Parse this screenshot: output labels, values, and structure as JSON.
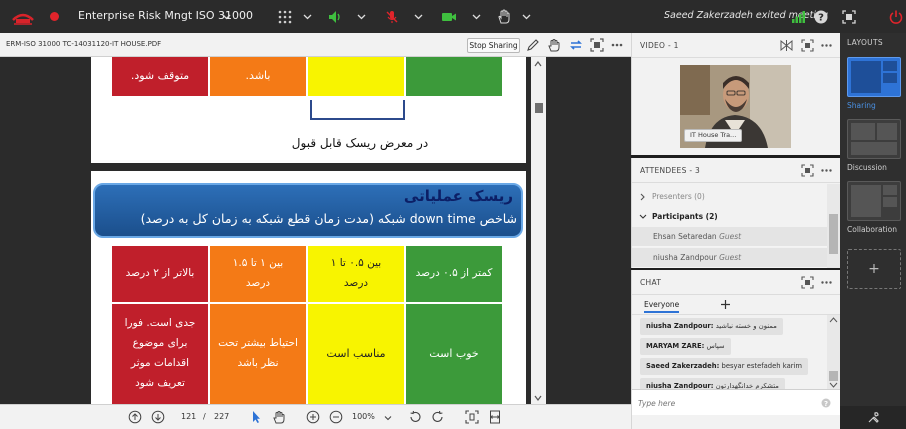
{
  "topbar": {
    "meeting_title": "Enterprise Risk Mngt ISO 31000",
    "status_message": "Saeed Zakerzadeh exited meeting"
  },
  "document": {
    "file_name": "ERM-ISO 31000 TC-14031120-IT HOUSE.PDF",
    "stop_sharing": "Stop Sharing",
    "current_page": "121",
    "page_separator": "/",
    "total_pages": "227",
    "zoom": "100%"
  },
  "slide_top": {
    "cells": [
      "متوقف شود.",
      "باشد."
    ],
    "acceptable_label": "در معرض ریسک قابل قبول"
  },
  "slide_bottom": {
    "title": "ریسک عملیاتی",
    "subtitle": "شاخص down time شبکه (مدت زمان قطع شبکه به زمان کل به درصد)",
    "header_cells": [
      "بالاتر از ۲ درصد",
      "بین ۱ تا ۱.۵ درصد",
      "بین ۰.۵ تا ۱ درصد",
      "کمتر از ۰.۵ درصد"
    ],
    "body_cells": [
      "جدی است. فورا برای موضوع اقدامات موثر تعریف شود",
      "احتیاط بیشتر تحت نظر باشد",
      "مناسب است",
      "خوب است"
    ]
  },
  "video_panel": {
    "title": "VIDEO",
    "count": "- 1",
    "video_label": "IT House Tra..."
  },
  "attendees_panel": {
    "title": "ATTENDEES",
    "count": "- 3",
    "presenters": "Presenters (0)",
    "participants": "Participants (2)",
    "people": [
      {
        "name": "Ehsan Setaredan",
        "role": "Guest"
      },
      {
        "name": "niusha Zandpour",
        "role": "Guest"
      }
    ]
  },
  "chat_panel": {
    "title": "CHAT",
    "tab": "Everyone",
    "messages": [
      {
        "sender": "niusha Zandpour:",
        "text": "ممنون و خسته نباشید"
      },
      {
        "sender": "MARYAM ZARE:",
        "text": "سپاس"
      },
      {
        "sender": "Saeed Zakerzadeh:",
        "text": "besyar estefadeh karim"
      },
      {
        "sender": "niusha Zandpour:",
        "text": "متشکرم خدانگهدارتون"
      }
    ],
    "input_placeholder": "Type here"
  },
  "layouts": {
    "title": "LAYOUTS",
    "items": [
      {
        "label": "Sharing",
        "active": true
      },
      {
        "label": "Discussion",
        "active": false
      },
      {
        "label": "Collaboration",
        "active": false
      }
    ],
    "add_symbol": "+"
  },
  "colors": {
    "accent_blue": "#2e73d6",
    "risk_red": "#c01f2b",
    "risk_orange": "#f47a16",
    "risk_yellow": "#f8f400",
    "risk_green": "#3c9a3a",
    "record_red": "#e0242b",
    "status_green": "#3fbf3f"
  },
  "icons": [
    "adobe-connect-logo-icon",
    "record-icon",
    "grid-menu-icon",
    "speaker-icon",
    "mic-muted-icon",
    "camera-icon",
    "raise-hand-icon",
    "signal-icon",
    "help-icon",
    "fullscreen-icon",
    "power-icon",
    "pen-icon",
    "hand-icon",
    "sync-icon",
    "expand-icon",
    "more-icon"
  ]
}
